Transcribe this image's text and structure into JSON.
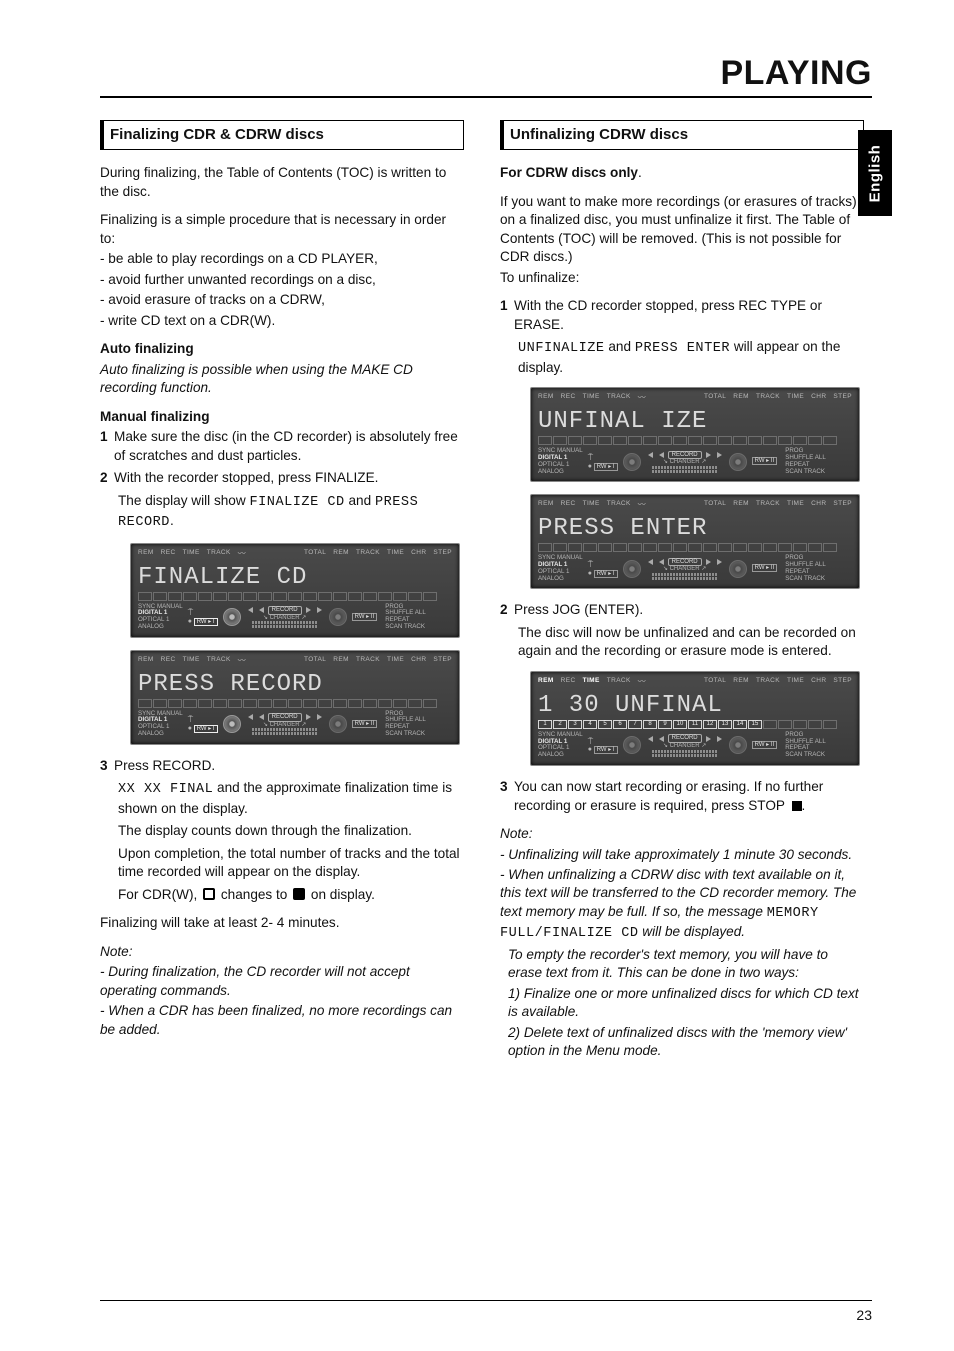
{
  "chapter_title": "PLAYING",
  "language_tab": "English",
  "page_number": "23",
  "left": {
    "section_head": "Finalizing CDR & CDRW discs",
    "intro": "During finalizing, the Table of Contents (TOC) is written to the disc.",
    "lead2": "Finalizing is a simple procedure that is necessary in order to:",
    "bullets": [
      "- be able to play recordings on a CD PLAYER,",
      "- avoid further unwanted recordings on a disc,",
      "- avoid erasure of tracks on a CDRW,",
      "- write CD text on a CDR(W)."
    ],
    "auto_head": "Auto finalizing",
    "auto_body": "Auto finalizing is possible when using the MAKE CD recording function.",
    "manual_head": "Manual finalizing",
    "step1_num": "1",
    "step1": "Make sure the disc (in the CD recorder) is absolutely free of scratches and dust particles.",
    "step2_num": "2",
    "step2": "With the recorder stopped, press FINALIZE.",
    "step2_line_a": "The display will show ",
    "step2_seg_a": "FINALIZE CD",
    "step2_line_b": " and ",
    "step2_seg_b": "PRESS RECORD",
    "step2_line_c": ".",
    "step3_num": "3",
    "step3": "Press RECORD.",
    "step3_line_a_seg": "XX XX FINAL",
    "step3_line_a_rest": " and the approximate finalization time is shown on the display.",
    "step3_line_b": "The display counts down through the finalization.",
    "step3_line_c": "Upon completion, the total number of tracks and the total time recorded will appear on the display.",
    "step3_line_d_a": "For CDR(W), ",
    "step3_line_d_b": " changes to ",
    "step3_line_d_c": " on display.",
    "closing": "Finalizing will take at least 2- 4 minutes.",
    "note_head": "Note:",
    "notes": [
      "- During finalization, the CD recorder will not accept operating  commands.",
      "- When a CDR has been finalized, no more recordings can be added."
    ]
  },
  "right": {
    "section_head": "Unfinalizing CDRW discs",
    "for_head": "For CDRW discs only",
    "intro1": "If you want to make more recordings (or erasures of tracks) on a finalized disc, you must unfinalize it first. The Table of Contents (TOC) will be removed. (This is not possible for CDR discs.)",
    "intro2": "To unfinalize:",
    "step1_num": "1",
    "step1": "With the CD recorder stopped, press REC TYPE or ERASE.",
    "step1_line_a_seg1": "UNFINALIZE",
    "step1_line_a_mid": " and ",
    "step1_line_a_seg2": "PRESS ENTER",
    "step1_line_a_end": " will appear on the display.",
    "step2_num": "2",
    "step2": "Press JOG (ENTER).",
    "step2_line_a": "The disc will now be unfinalized and can be recorded on again and the recording or erasure mode is entered.",
    "step3_num": "3",
    "step3_a": "You can now start recording or erasing. If no further recording or erasure is required, press STOP ",
    "step3_b": ".",
    "note_head": "Note:",
    "notes_a": "- Unfinalizing will take approximately 1 minute 30 seconds.",
    "notes_b1": "- When unfinalizing a CDRW disc with text available on it, this text will be transferred to the CD recorder memory. The text memory may be full. If so, the message ",
    "notes_b_seg": "MEMORY FULL/FINALIZE CD",
    "notes_b2": " will be displayed.",
    "notes_c": "To empty the recorder's text memory, you will have to erase text from it. This can be done in two ways:",
    "notes_d": "1) Finalize one or more unfinalized discs for which CD text is available.",
    "notes_e": "2) Delete text of unfinalized discs with the 'memory view' option in the Menu mode."
  },
  "lcd_labels": {
    "top": [
      "REM",
      "REC",
      "TIME",
      "TRACK",
      "TOTAL",
      "REM",
      "TRACK",
      "TIME",
      "CHR",
      "STEP"
    ],
    "left_stack": [
      "SYNC",
      "MANUAL",
      "DIGITAL 1",
      "OPTICAL 1",
      "ANALOG"
    ],
    "right_stack": [
      "PROG",
      "SHUFFLE   ALL",
      "REPEAT",
      "SCAN   TRACK"
    ],
    "changer": "CHANGER",
    "record": "RECORD",
    "rw": "RW"
  },
  "lcds": {
    "finalize": "FINALIZE  CD",
    "press_record": "PRESS  RECORD",
    "unfinalize": "UNFINAL IZE",
    "press_enter": "PRESS  ENTER",
    "unfinal130": "  1 30  UNFINAL"
  },
  "lcd_tracks_empty": [
    "",
    "",
    "",
    "",
    "",
    "",
    "",
    "",
    "",
    "",
    "",
    "",
    "",
    "",
    "",
    "",
    "",
    "",
    "",
    ""
  ],
  "lcd_tracks_15": [
    "1",
    "2",
    "3",
    "4",
    "5",
    "6",
    "7",
    "8",
    "9",
    "10",
    "11",
    "12",
    "13",
    "14",
    "15",
    "",
    "",
    "",
    "",
    ""
  ]
}
